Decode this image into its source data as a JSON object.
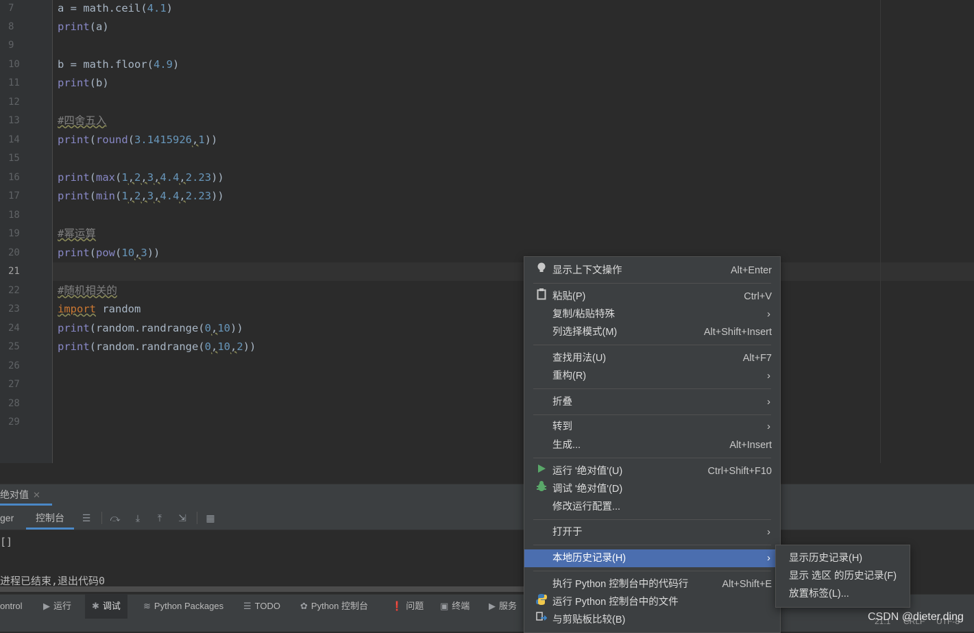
{
  "editor": {
    "line_numbers": [
      "7",
      "8",
      "9",
      "10",
      "11",
      "12",
      "13",
      "14",
      "15",
      "16",
      "17",
      "18",
      "19",
      "20",
      "21",
      "22",
      "23",
      "24",
      "25",
      "26",
      "27",
      "28",
      "29"
    ],
    "current_line": "21",
    "code": {
      "l7": {
        "a": "a = math.ceil(",
        "n": "4.1",
        "b": ")"
      },
      "l8": {
        "p": "print",
        "b": "(a)"
      },
      "l10": {
        "a": "b = math.floor(",
        "n": "4.9",
        "b": ")"
      },
      "l11": {
        "p": "print",
        "b": "(b)"
      },
      "l13": "#四舍五入",
      "l14": {
        "p": "print",
        "o": "(",
        "f": "round",
        "o2": "(",
        "n1": "3.1415926",
        ",": ",",
        "n2": "1",
        "c": "))"
      },
      "l16": {
        "p": "print",
        "o": "(",
        "f": "max",
        "o2": "(",
        "n1": "1",
        "n2": "2",
        "n3": "3",
        "n4": "4.4",
        "n5": "2.23",
        "c": "))"
      },
      "l17": {
        "p": "print",
        "o": "(",
        "f": "min",
        "o2": "(",
        "n1": "1",
        "n2": "2",
        "n3": "3",
        "n4": "4.4",
        "n5": "2.23",
        "c": "))"
      },
      "l19": "#幂运算",
      "l20": {
        "p": "print",
        "o": "(",
        "f": "pow",
        "o2": "(",
        "n1": "10",
        "n2": "3",
        "c": "))"
      },
      "l22": "#随机相关的",
      "l23": {
        "k": "import",
        "r": " random"
      },
      "l24": {
        "p": "print",
        "m": "(random.randrange(",
        "n1": "0",
        "n2": "10",
        "c": "))"
      },
      "l25": {
        "p": "print",
        "m": "(random.randrange(",
        "n1": "0",
        "n2": "10",
        "n3": "2",
        "c": "))"
      }
    },
    "comma": ","
  },
  "run_tab": {
    "label": "绝对值",
    "close": "✕"
  },
  "console_tabs": {
    "debugger_partial": "ger",
    "console": "控制台"
  },
  "console": {
    "line1": "[]",
    "line2": "进程已结束,退出代码0"
  },
  "bottom_tools": [
    {
      "label": "ontrol",
      "icon": ""
    },
    {
      "label": "运行",
      "icon": "▶"
    },
    {
      "label": "调试",
      "icon": "✱"
    },
    {
      "label": "Python Packages",
      "icon": "≋"
    },
    {
      "label": "TODO",
      "icon": "☰"
    },
    {
      "label": "Python 控制台",
      "icon": "✿"
    },
    {
      "label": "问题",
      "icon": "❗"
    },
    {
      "label": "终端",
      "icon": "▣"
    },
    {
      "label": "服务",
      "icon": "▶"
    }
  ],
  "status": {
    "position": "21:1",
    "line_sep": "CRLF",
    "encoding": "UTF-8"
  },
  "watermark": "CSDN @dieter.ding",
  "context_menu": {
    "items": [
      {
        "label": "显示上下文操作",
        "shortcut": "Alt+Enter",
        "icon": "bulb-icon"
      },
      {
        "label": "粘贴(P)",
        "shortcut": "Ctrl+V",
        "icon": "clipboard-icon"
      },
      {
        "label": "复制/粘贴特殊",
        "shortcut": "",
        "arrow": "›"
      },
      {
        "label": "列选择模式(M)",
        "shortcut": "Alt+Shift+Insert"
      },
      {
        "label": "查找用法(U)",
        "shortcut": "Alt+F7"
      },
      {
        "label": "重构(R)",
        "shortcut": "",
        "arrow": "›"
      },
      {
        "label": "折叠",
        "shortcut": "",
        "arrow": "›"
      },
      {
        "label": "转到",
        "shortcut": "",
        "arrow": "›"
      },
      {
        "label": "生成...",
        "shortcut": "Alt+Insert"
      },
      {
        "label": "运行 '绝对值'(U)",
        "shortcut": "Ctrl+Shift+F10",
        "icon": "run-icon"
      },
      {
        "label": "调试 '绝对值'(D)",
        "shortcut": "",
        "icon": "debug-icon"
      },
      {
        "label": "修改运行配置...",
        "shortcut": ""
      },
      {
        "label": "打开于",
        "shortcut": "",
        "arrow": "›"
      },
      {
        "label": "本地历史记录(H)",
        "shortcut": "",
        "arrow": "›"
      },
      {
        "label": "执行 Python 控制台中的代码行",
        "shortcut": "Alt+Shift+E"
      },
      {
        "label": "运行 Python 控制台中的文件",
        "shortcut": "",
        "icon": "python-icon"
      },
      {
        "label": "与剪贴板比较(B)",
        "shortcut": "",
        "icon": "compare-icon"
      }
    ],
    "highlighted": "本地历史记录(H)"
  },
  "submenu": {
    "items": [
      "显示历史记录(H)",
      "显示 选区 的历史记录(F)",
      "放置标签(L)..."
    ]
  },
  "colors": {
    "accent": "#4b6eaf",
    "background": "#2b2b2b",
    "panel": "#3c3f41"
  }
}
